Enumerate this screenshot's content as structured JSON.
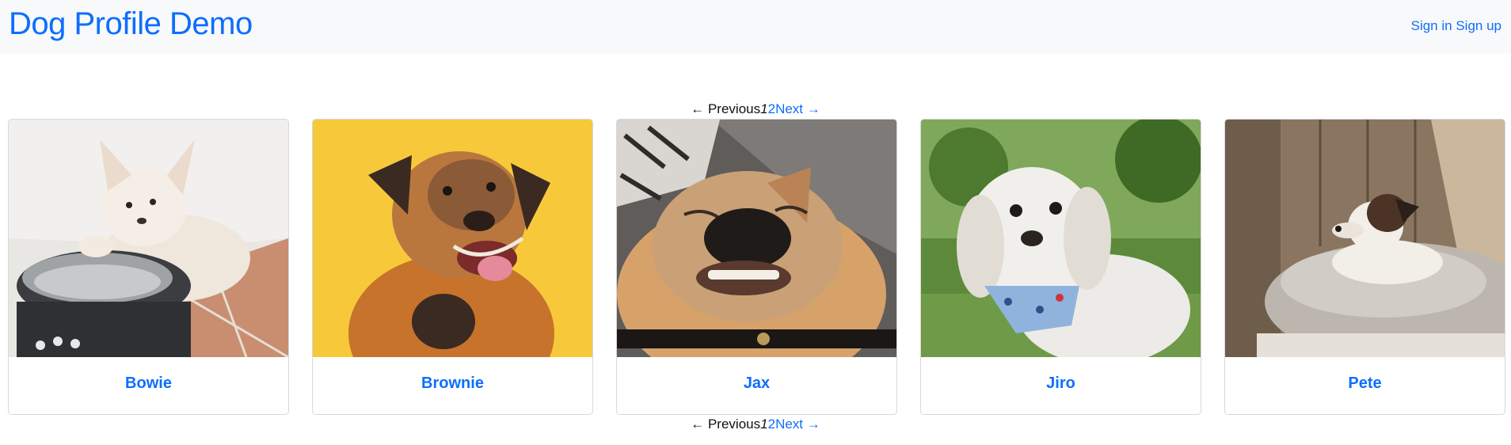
{
  "navbar": {
    "brand": "Dog Profile Demo",
    "sign_in": "Sign in",
    "sign_up": "Sign up"
  },
  "pagination": {
    "previous": "← Previous",
    "current_page": "1",
    "next_page": "2",
    "next": "Next →"
  },
  "dogs": [
    {
      "name": "Bowie",
      "photo": "dog-photo-bowie"
    },
    {
      "name": "Brownie",
      "photo": "dog-photo-brownie"
    },
    {
      "name": "Jax",
      "photo": "dog-photo-jax"
    },
    {
      "name": "Jiro",
      "photo": "dog-photo-jiro"
    },
    {
      "name": "Pete",
      "photo": "dog-photo-pete"
    }
  ],
  "colors": {
    "link": "#0d6efd",
    "navbar_bg": "#f8f9fa",
    "card_border": "#d6d8db"
  }
}
